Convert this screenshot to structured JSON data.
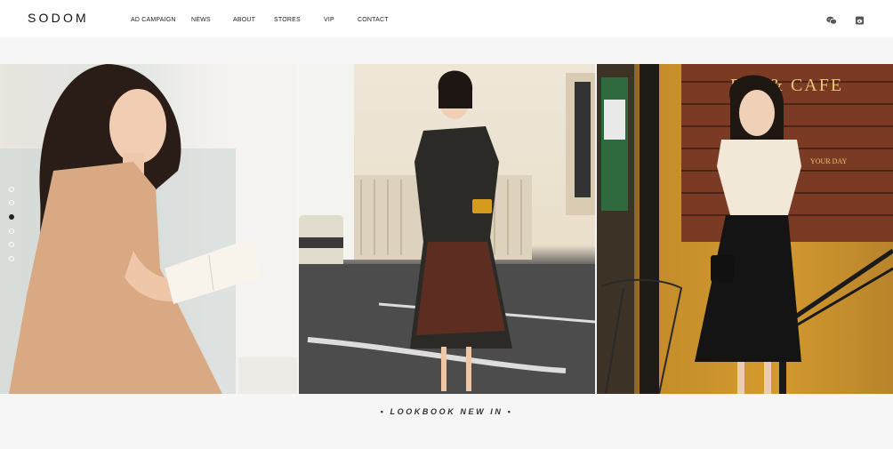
{
  "brand": {
    "logo": "SODOM"
  },
  "nav": {
    "items": [
      {
        "label": "AD CAMPAIGN"
      },
      {
        "label": "NEWS"
      },
      {
        "label": "ABOUT"
      },
      {
        "label": "STORES"
      },
      {
        "label": "VIP"
      },
      {
        "label": "CONTACT"
      }
    ]
  },
  "header_icons": [
    {
      "name": "wechat-icon"
    },
    {
      "name": "weibo-icon"
    }
  ],
  "carousel": {
    "slides": [
      {
        "name": "lookbook-photo-1"
      },
      {
        "name": "lookbook-photo-2"
      },
      {
        "name": "lookbook-photo-3"
      }
    ],
    "dots_count": 6,
    "active_dot": 3,
    "cafe_sign": "PAI & CAFE",
    "window_text": "YOUR DAY"
  },
  "caption": "•   LOOKBOOK NEW IN   •",
  "colors": {
    "accent": "#222222",
    "background": "#f6f6f6"
  }
}
